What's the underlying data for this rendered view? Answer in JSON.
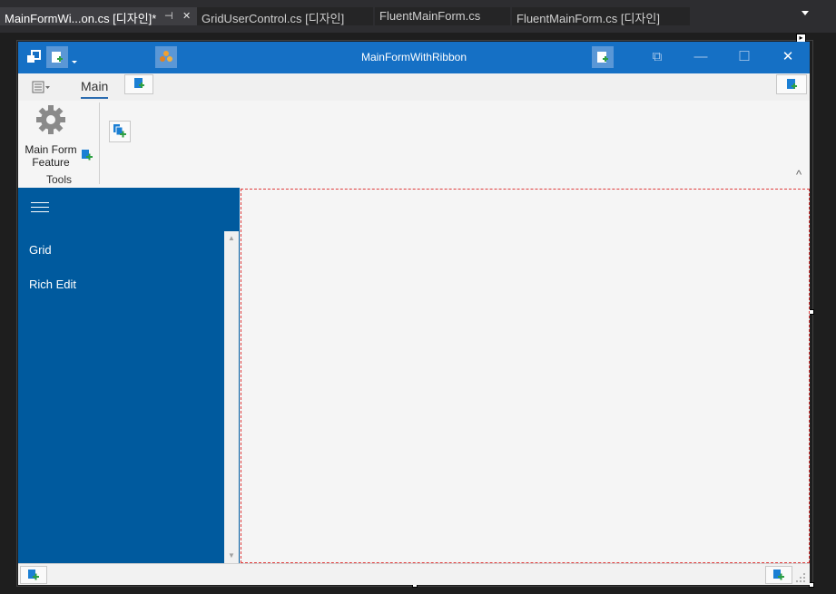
{
  "vs_tabs": [
    {
      "label": "MainFormWi...on.cs [디자인]*",
      "active": true
    },
    {
      "label": "GridUserControl.cs [디자인]",
      "active": false
    },
    {
      "label": "FluentMainForm.cs",
      "active": false
    },
    {
      "label": "FluentMainForm.cs [디자인]",
      "active": false
    }
  ],
  "tab_icons": {
    "pin": "pin-icon",
    "close": "close-icon",
    "overflow": "dropdown-icon"
  },
  "form": {
    "title": "MainFormWithRibbon",
    "window_buttons": {
      "restore_label": "⧉",
      "minimize_label": "—",
      "maximize_label": "☐",
      "close_label": "✕"
    }
  },
  "ribbon": {
    "tabs": [
      {
        "label": "Main"
      }
    ],
    "groups": [
      {
        "label": "Tools",
        "items": [
          {
            "label": "Main Form\nFeature",
            "icon": "gear-icon"
          }
        ]
      }
    ],
    "collapse_label": "^"
  },
  "accordion": {
    "items": [
      {
        "label": "Grid"
      },
      {
        "label": "Rich Edit"
      }
    ],
    "scroll_up": "▲",
    "scroll_down": "▼"
  },
  "colors": {
    "title_bar": "#1570c5",
    "accordion_bg": "#005a9e",
    "selection_dashed": "#e03c3c",
    "add_glyph": "#1b7fd4",
    "add_plus": "#2ea043"
  }
}
